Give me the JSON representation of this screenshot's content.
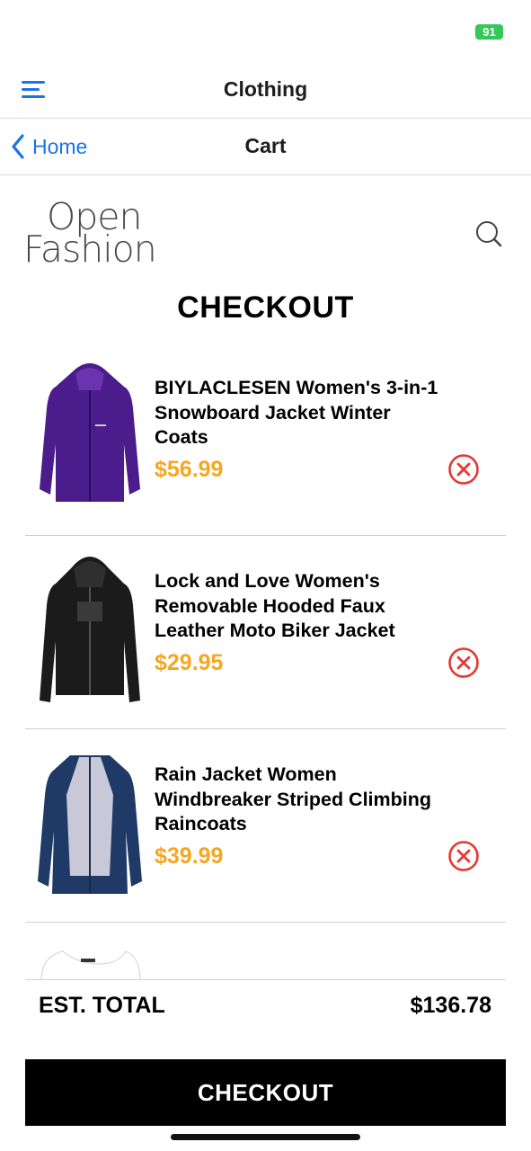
{
  "status_bar": {
    "battery": "91"
  },
  "header": {
    "title": "Clothing"
  },
  "nav": {
    "back_label": "Home",
    "title": "Cart"
  },
  "brand": {
    "logo_line1": "Open",
    "logo_line2": "Fashion"
  },
  "page": {
    "title": "CHECKOUT"
  },
  "cart": {
    "items": [
      {
        "name": "BIYLACLESEN Women's 3-in-1 Snowboard Jacket Winter Coats",
        "price": "$56.99",
        "color": "#4b1c8c"
      },
      {
        "name": "Lock and Love Women's Removable Hooded Faux Leather Moto Biker Jacket",
        "price": "$29.95",
        "color": "#1b1b1b"
      },
      {
        "name": "Rain Jacket Women Windbreaker Striped Climbing Raincoats",
        "price": "$39.99",
        "color": "#1f3a66"
      }
    ]
  },
  "total": {
    "label": "EST. TOTAL",
    "value": "$136.78"
  },
  "checkout_button": {
    "label": "CHECKOUT"
  },
  "colors": {
    "accent": "#1a73e8",
    "price": "#f5a623",
    "remove": "#e53935",
    "battery": "#34c759"
  },
  "icons": [
    "menu-icon",
    "chevron-left-icon",
    "search-icon",
    "remove-circle-icon"
  ]
}
